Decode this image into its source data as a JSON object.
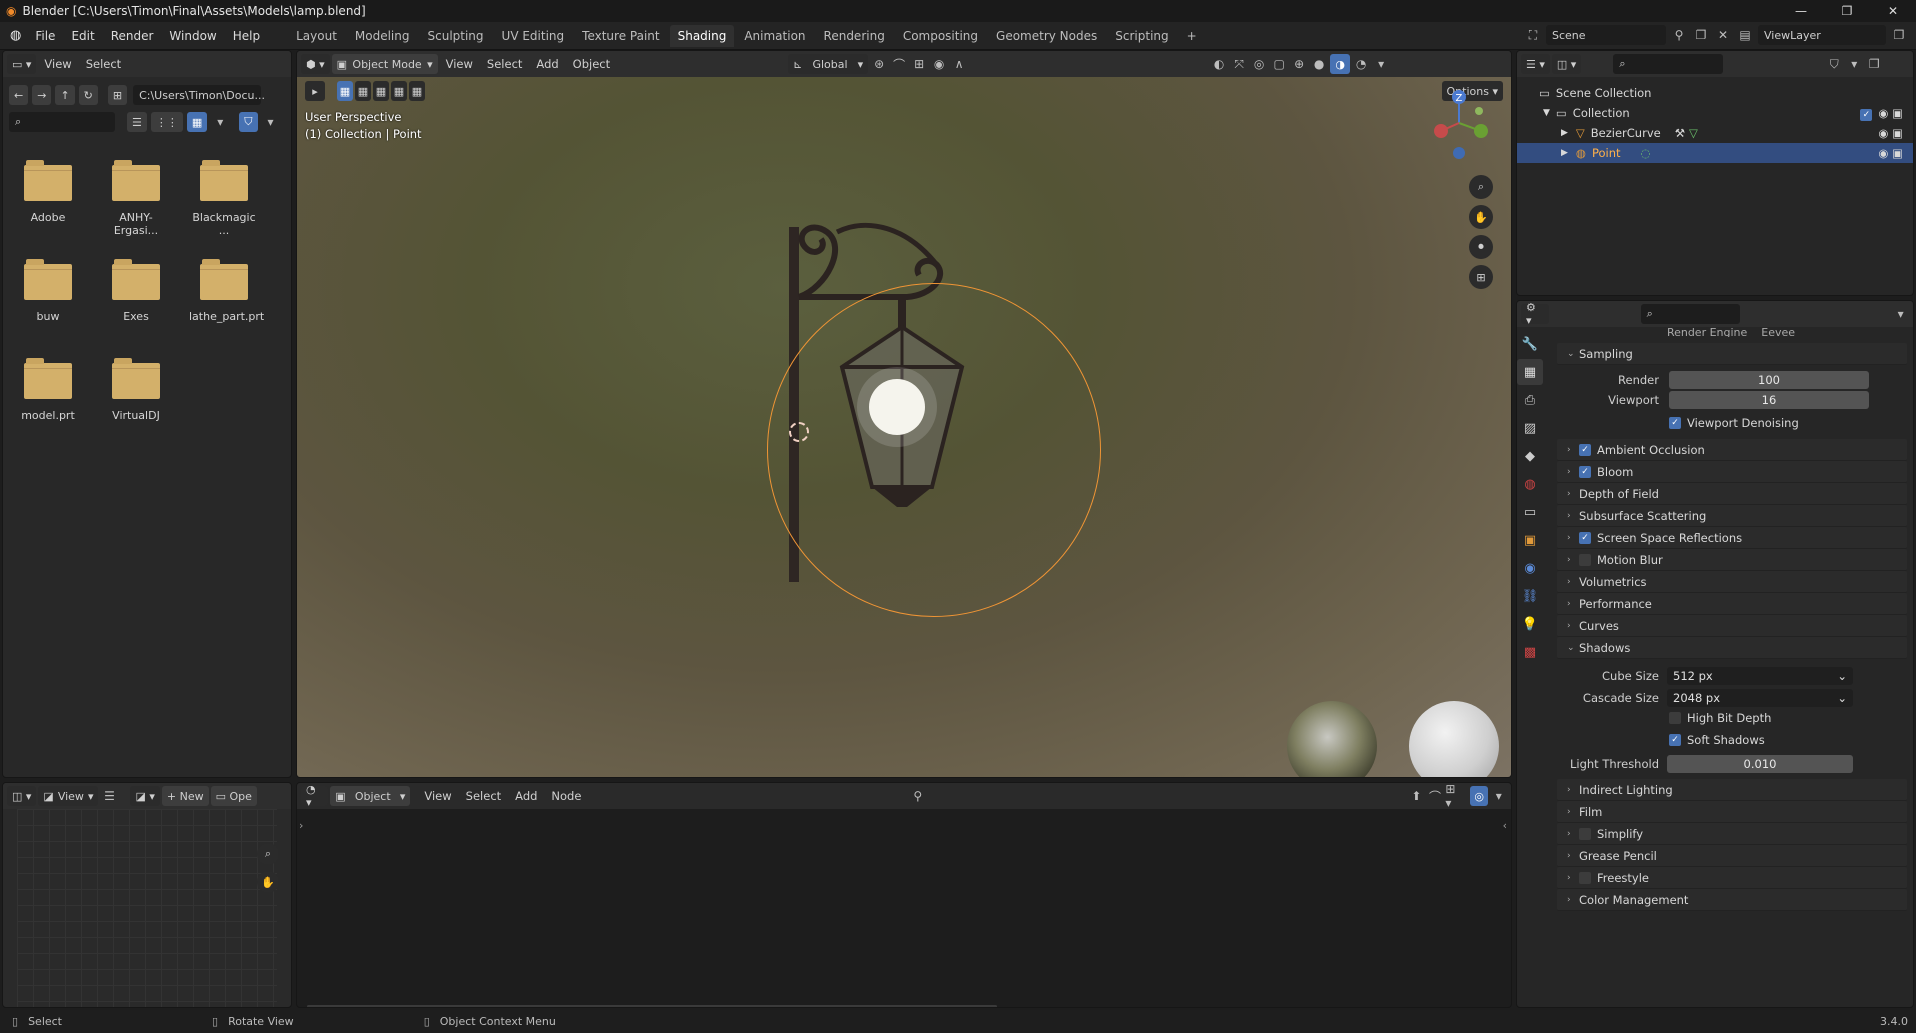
{
  "window": {
    "title": "Blender [C:\\Users\\Timon\\Final\\Assets\\Models\\lamp.blend]",
    "controls": [
      "—",
      "❐",
      "✕"
    ]
  },
  "menus": [
    "File",
    "Edit",
    "Render",
    "Window",
    "Help"
  ],
  "workspaces": [
    "Layout",
    "Modeling",
    "Sculpting",
    "UV Editing",
    "Texture Paint",
    "Shading",
    "Animation",
    "Rendering",
    "Compositing",
    "Geometry Nodes",
    "Scripting"
  ],
  "active_workspace": "Shading",
  "scene": {
    "name": "Scene",
    "view_layer": "ViewLayer"
  },
  "file_browser": {
    "menu": [
      "View",
      "Select"
    ],
    "path": "C:\\Users\\Timon\\Docu...",
    "folders": [
      "Adobe",
      "ANHY-Ergasi...",
      "Blackmagic ...",
      "buw",
      "Exes",
      "lathe_part.prt",
      "model.prt",
      "VirtualDJ"
    ]
  },
  "viewport": {
    "mode": "Object Mode",
    "menu": [
      "View",
      "Select",
      "Add",
      "Object"
    ],
    "orientation": "Global",
    "options_label": "Options",
    "overlay_line1": "User Perspective",
    "overlay_line2": "(1) Collection | Point",
    "gizmo_z": "Z"
  },
  "image_editor": {
    "view_label": "View",
    "new_label": "New",
    "open_label": "Ope"
  },
  "node_editor": {
    "mode": "Object",
    "menu": [
      "View",
      "Select",
      "Add",
      "Node"
    ]
  },
  "outliner": {
    "scene_collection": "Scene Collection",
    "collection": "Collection",
    "items": [
      "BezierCurve",
      "Point"
    ]
  },
  "properties": {
    "render_engine_label": "Render Engine",
    "render_engine_value": "Eevee",
    "sampling": {
      "label": "Sampling",
      "render_label": "Render",
      "render_value": "100",
      "viewport_label": "Viewport",
      "viewport_value": "16",
      "denoise_label": "Viewport Denoising"
    },
    "sections": [
      {
        "label": "Ambient Occlusion",
        "check": true
      },
      {
        "label": "Bloom",
        "check": true
      },
      {
        "label": "Depth of Field"
      },
      {
        "label": "Subsurface Scattering"
      },
      {
        "label": "Screen Space Reflections",
        "check": true
      },
      {
        "label": "Motion Blur",
        "check": false
      },
      {
        "label": "Volumetrics"
      },
      {
        "label": "Performance"
      },
      {
        "label": "Curves"
      }
    ],
    "shadows": {
      "label": "Shadows",
      "cube_size_label": "Cube Size",
      "cube_size_value": "512 px",
      "cascade_size_label": "Cascade Size",
      "cascade_size_value": "2048 px",
      "high_bit_depth": "High Bit Depth",
      "soft_shadows": "Soft Shadows",
      "light_threshold_label": "Light Threshold",
      "light_threshold_value": "0.010"
    },
    "sections_after": [
      {
        "label": "Indirect Lighting"
      },
      {
        "label": "Film"
      },
      {
        "label": "Simplify",
        "check": false
      },
      {
        "label": "Grease Pencil"
      },
      {
        "label": "Freestyle",
        "check": false
      },
      {
        "label": "Color Management"
      }
    ]
  },
  "status_bar": {
    "select": "Select",
    "rotate": "Rotate View",
    "context": "Object Context Menu",
    "version": "3.4.0"
  }
}
